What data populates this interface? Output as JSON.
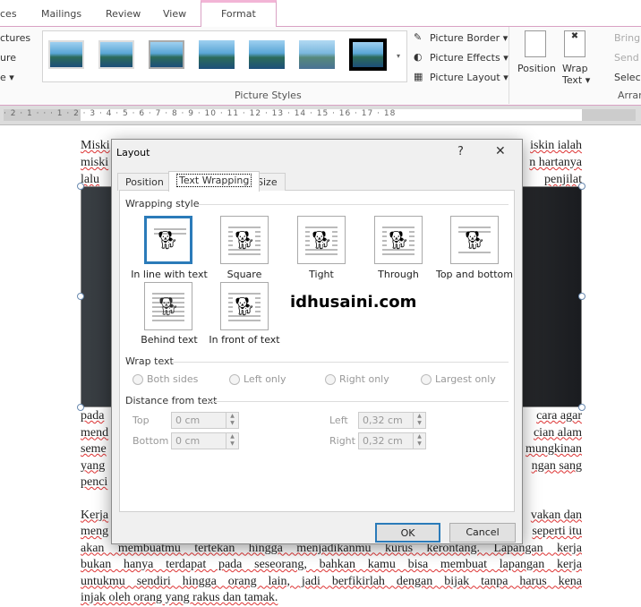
{
  "ribbon": {
    "tabs": [
      "ces",
      "Mailings",
      "Review",
      "View",
      "Format"
    ],
    "left_items": [
      "ctures",
      "ure",
      "e ▾"
    ],
    "group_picture_styles": "Picture Styles",
    "picture_border": "Picture Border ▾",
    "picture_effects": "Picture Effects ▾",
    "picture_layout": "Picture Layout ▾",
    "position": "Position",
    "wrap_text": "Wrap Text ▾",
    "bring": "Bring",
    "send": "Send",
    "select": "Select",
    "arrange": "Arrar"
  },
  "ruler": "· 2 · 1 · · · 1 · 2 · 3 · 4 · 5 · 6 · 7 · 8 · 9 · 10 · 11 · 12 · 13 · 14 · 15 · 16 · 17 · 18",
  "document": {
    "left": [
      "Miski",
      "miski",
      "lalu",
      "pada",
      "mend",
      "seme",
      "yang",
      "penci",
      "Kerja",
      "meng"
    ],
    "right": [
      "iskin ialah",
      "n hartanya",
      "penjilat",
      "cara agar",
      "cian alam",
      "mungkinan",
      "ngan sang",
      "",
      "vakan dan",
      "seperti itu"
    ],
    "full": [
      "akan membuatmu tertekan hingga menjadikanmu kurus kerontang. Lapangan kerja",
      "bukan hanya terdapat pada seseorang, bahkan kamu bisa membuat lapangan kerja",
      "untukmu sendiri hingga orang lain, jadi berfikirlah dengan bijak tanpa harus kena",
      "injak oleh orang yang rakus dan tamak."
    ]
  },
  "dialog": {
    "title": "Layout",
    "help": "?",
    "close": "✕",
    "tabs": [
      "Position",
      "Text Wrapping",
      "Size"
    ],
    "wrapping_style": "Wrapping style",
    "options": [
      "In line with text",
      "Square",
      "Tight",
      "Through",
      "Top and bottom",
      "Behind text",
      "In front of text"
    ],
    "watermark": "idhusaini.com",
    "wrap_text": "Wrap text",
    "radios": [
      "Both sides",
      "Left only",
      "Right only",
      "Largest only"
    ],
    "distance": "Distance from text",
    "top_label": "Top",
    "top_value": "0 cm",
    "bottom_label": "Bottom",
    "bottom_value": "0 cm",
    "left_label": "Left",
    "left_value": "0,32 cm",
    "right_label": "Right",
    "right_value": "0,32 cm",
    "ok": "OK",
    "cancel": "Cancel"
  }
}
